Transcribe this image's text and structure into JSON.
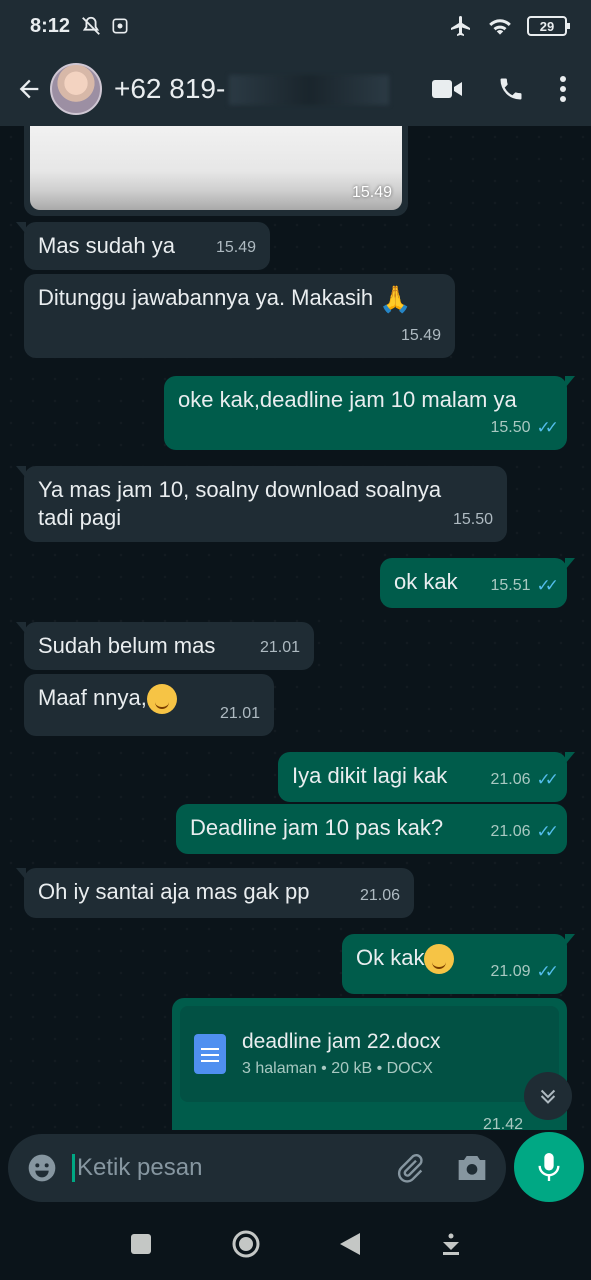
{
  "status_bar": {
    "time": "8:12",
    "battery": "29"
  },
  "header": {
    "contact_name": "+62 819-"
  },
  "messages": [
    {
      "text": "Mas sudah ya",
      "time": "15.49"
    },
    {
      "text": "Ditunggu jawabannya ya. Makasih",
      "time": "15.49"
    },
    {
      "text": "oke kak,deadline jam 10 malam ya",
      "time": "15.50"
    },
    {
      "text": "Ya mas jam 10, soalny download soalnya",
      "text2": "tadi pagi",
      "time": "15.50"
    },
    {
      "text": "ok kak",
      "time": "15.51"
    },
    {
      "text": "Sudah belum mas",
      "time": "21.01"
    },
    {
      "text": "Maaf nnya,",
      "time": "21.01"
    },
    {
      "text": "Iya dikit lagi kak",
      "time": "21.06"
    },
    {
      "text": "Deadline jam 10 pas kak?",
      "time": "21.06"
    },
    {
      "text": "Oh iy santai aja mas gak pp",
      "time": "21.06"
    },
    {
      "text": "Ok kak",
      "time": "21.09"
    }
  ],
  "image_message": {
    "time": "15.49"
  },
  "document": {
    "name": "deadline jam 22.docx",
    "info": "3 halaman • 20 kB • DOCX",
    "time": "21.42"
  },
  "input": {
    "placeholder": "Ketik pesan"
  },
  "colors": {
    "incoming": "#1f2c34",
    "outgoing": "#005c4b",
    "accent": "#00a884",
    "read_ticks": "#53bdeb"
  },
  "icons": [
    "back-arrow-icon",
    "video-call-icon",
    "phone-icon",
    "more-icon",
    "emoji-icon",
    "attach-icon",
    "camera-icon",
    "mic-icon",
    "scroll-down-icon",
    "document-icon"
  ]
}
